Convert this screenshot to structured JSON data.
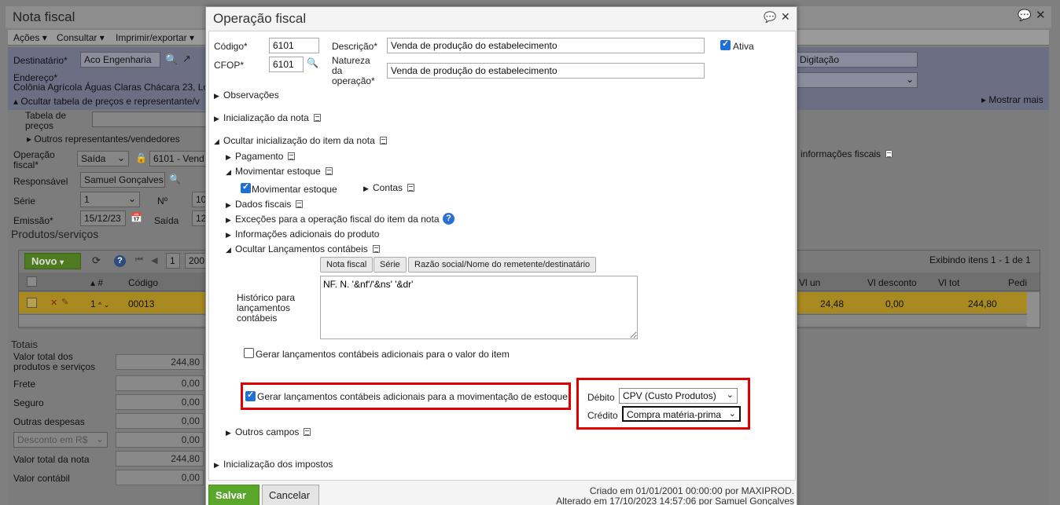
{
  "bg": {
    "title": "Nota fiscal",
    "menu": [
      "Ações",
      "Consultar",
      "Imprimir/exportar"
    ],
    "destinatario_label": "Destinatário*",
    "destinatario_value": "Aco Engenharia",
    "digitacao": "Digitação",
    "endereco_label": "Endereço*",
    "endereco_value": "Colônia Agrícola Águas Claras Chácara 23, Lo",
    "ocultar_tabela": "Ocultar tabela de preços e representante/v",
    "mostrar_mais": "Mostrar mais",
    "tabela_precos_label": "Tabela de preços",
    "outros_repr": "Outros representantes/vendedores",
    "informacoes_fiscais": "informações fiscais",
    "operacao_fiscal_label": "Operação fiscal*",
    "operacao_tipo": "Saída",
    "operacao_value": "6101 - Vend",
    "responsavel_label": "Responsável",
    "responsavel_value": "Samuel Gonçalves",
    "serie_label": "Série",
    "serie_value": "1",
    "nr_label": "Nº",
    "nr_value": "10",
    "emissao_label": "Emissão*",
    "emissao_value": "15/12/23",
    "saida_label": "Saída",
    "saida_value": "12",
    "produtos_title": "Produtos/serviços",
    "novo_button": "Novo",
    "page_num": "1",
    "page_size": "200",
    "exibindo": "Exibindo itens 1 - 1 de 1",
    "col_hash": "#",
    "col_codigo": "Código",
    "col_vl_un": "Vl un",
    "col_vl_desconto": "Vl desconto",
    "col_vl_tot": "Vl tot",
    "col_pedi": "Pedi",
    "row": {
      "num": "1",
      "codigo": "00013",
      "vl_un": "24,48",
      "vl_desconto": "0,00",
      "vl_tot": "244,80"
    },
    "totais_title": "Totais",
    "totais": [
      {
        "label": "Valor total dos produtos e serviços",
        "value": "244,80"
      },
      {
        "label": "Frete",
        "value": "0,00"
      },
      {
        "label": "Seguro",
        "value": "0,00"
      },
      {
        "label": "Outras despesas",
        "value": "0,00"
      },
      {
        "label": "Desconto em R$",
        "value": "0,00"
      },
      {
        "label": "Valor total da nota",
        "value": "244,80"
      },
      {
        "label": "Valor contábil",
        "value": "0,00"
      }
    ]
  },
  "modal": {
    "title": "Operação fiscal",
    "codigo_label": "Código*",
    "codigo_value": "6101",
    "descricao_label": "Descrição*",
    "descricao_value": "Venda de produção do estabelecimento",
    "ativa_label": "Ativa",
    "cfop_label": "CFOP*",
    "cfop_value": "6101",
    "natureza_label": "Natureza da operação*",
    "natureza_value": "Venda de produção do estabelecimento",
    "observacoes": "Observações",
    "inicializacao_nota": "Inicialização da nota",
    "ocultar_inicializacao_item": "Ocultar inicialização do item da nota",
    "pagamento": "Pagamento",
    "movimentar_estoque_section": "Movimentar estoque",
    "movimentar_estoque_check": "Movimentar estoque",
    "contas": "Contas",
    "dados_fiscais": "Dados fiscais",
    "excecoes": "Exceções para a operação fiscal do item da nota",
    "info_adicionais": "Informações adicionais do produto",
    "ocultar_lancamentos": "Ocultar Lançamentos contábeis",
    "btn_nota_fiscal": "Nota fiscal",
    "btn_serie": "Série",
    "btn_razao_social": "Razão social/Nome do remetente/destinatário",
    "historico_label": "Histórico para lançamentos contábeis",
    "historico_value": "NF. N. '&nf'/'&ns' '&dr'",
    "gerar_valor_item": "Gerar lançamentos contábeis adicionais para o valor do item",
    "gerar_mov_estoque": "Gerar lançamentos contábeis adicionais para a movimentação de estoque",
    "debito_label": "Débito",
    "debito_value": "CPV (Custo Produtos)",
    "credito_label": "Crédito",
    "credito_value": "Compra matéria-prima",
    "outros_campos": "Outros campos",
    "inicializacao_impostos": "Inicialização dos impostos",
    "salvar": "Salvar",
    "cancelar": "Cancelar",
    "criado_em": "Criado em 01/01/2001 00:00:00 por MAXIPROD.",
    "alterado_em": "Alterado em 17/10/2023 14:57:06 por Samuel Gonçalves"
  },
  "colors": {
    "accent_red": "#e00000",
    "save_green": "#5aa62a",
    "checkbox_blue": "#1e6fd6",
    "highlight_row": "#a88a20"
  }
}
